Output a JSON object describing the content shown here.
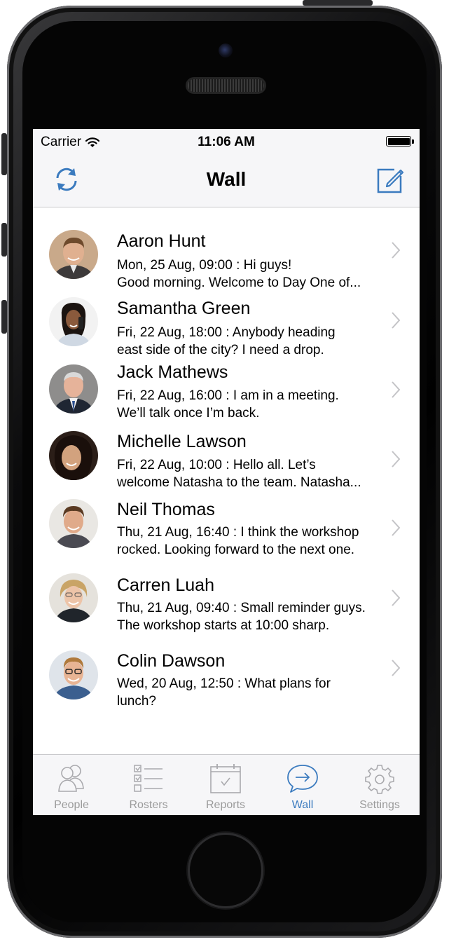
{
  "status_bar": {
    "carrier": "Carrier",
    "time": "11:06 AM"
  },
  "nav": {
    "title": "Wall",
    "left_icon": "refresh-icon",
    "right_icon": "compose-icon"
  },
  "colors": {
    "accent": "#3b7bbf",
    "inactive": "#9b9b9b",
    "bar_bg": "#f6f6f8"
  },
  "posts": [
    {
      "name": "Aaron Hunt",
      "line1": "Mon, 25 Aug, 09:00 : Hi guys!",
      "line2": "Good morning. Welcome to Day One of..."
    },
    {
      "name": "Samantha Green",
      "line1": "Fri, 22 Aug, 18:00 : Anybody heading",
      "line2": "east side of the city? I need a drop."
    },
    {
      "name": "Jack Mathews",
      "line1": "Fri, 22 Aug, 16:00 : I am in a meeting.",
      "line2": "We’ll talk once I’m back."
    },
    {
      "name": "Michelle Lawson",
      "line1": "Fri, 22 Aug, 10:00 : Hello all. Let’s",
      "line2": "welcome Natasha to the team. Natasha..."
    },
    {
      "name": "Neil Thomas",
      "line1": "Thu, 21 Aug, 16:40 : I think the workshop",
      "line2": "rocked. Looking forward to the next one."
    },
    {
      "name": "Carren Luah",
      "line1": "Thu, 21 Aug, 09:40 : Small reminder guys.",
      "line2": "The workshop starts at 10:00 sharp."
    },
    {
      "name": "Colin Dawson",
      "line1": "Wed, 20 Aug, 12:50 : What plans for",
      "line2": "lunch?"
    }
  ],
  "tabs": [
    {
      "label": "People",
      "icon": "people-icon",
      "active": false
    },
    {
      "label": "Rosters",
      "icon": "checklist-icon",
      "active": false
    },
    {
      "label": "Reports",
      "icon": "calendar-check-icon",
      "active": false
    },
    {
      "label": "Wall",
      "icon": "chat-bubble-arrow-icon",
      "active": true
    },
    {
      "label": "Settings",
      "icon": "gear-icon",
      "active": false
    }
  ]
}
